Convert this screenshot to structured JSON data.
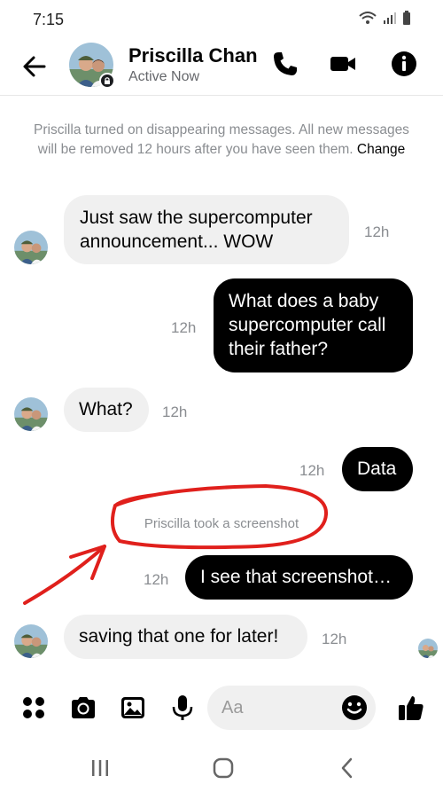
{
  "status_bar": {
    "time": "7:15",
    "icons": [
      "wifi-icon",
      "signal-icon",
      "battery-icon"
    ]
  },
  "header": {
    "contact_name": "Priscilla Chan",
    "contact_status": "Active Now",
    "icons": [
      "back-arrow-icon",
      "phone-icon",
      "video-camera-icon",
      "info-icon"
    ]
  },
  "notice": {
    "text": "Priscilla turned on disappearing messages. All new messages will be removed 12 hours after you have seen them.",
    "action": "Change"
  },
  "messages": [
    {
      "from": "Priscilla",
      "direction": "incoming",
      "text_lines": [
        "Just saw the supercomputer",
        "announcement... WOW"
      ],
      "time": "12h"
    },
    {
      "from": "me",
      "direction": "outgoing",
      "text_lines": [
        "What does a baby",
        "supercomputer call",
        "their father?"
      ],
      "time": "12h"
    },
    {
      "from": "Priscilla",
      "direction": "incoming",
      "text_lines": [
        "What?"
      ],
      "time": "12h"
    },
    {
      "from": "me",
      "direction": "outgoing",
      "text_lines": [
        "Data"
      ],
      "time": "12h"
    },
    {
      "from": "me",
      "direction": "outgoing",
      "text_lines": [
        "I see that screenshot…"
      ],
      "time": "12h"
    },
    {
      "from": "Priscilla",
      "direction": "incoming",
      "text_lines": [
        "saving that one for later!"
      ],
      "time": "12h"
    }
  ],
  "screenshot_notice": "Priscilla took a screenshot",
  "annotation": {
    "shape": "circle-and-arrow",
    "color": "#e0201c"
  },
  "composer": {
    "placeholder": "Aa",
    "value": "",
    "icons": [
      "apps-grid-icon",
      "camera-icon",
      "image-gallery-icon",
      "microphone-icon",
      "emoji-icon",
      "thumbs-up-icon"
    ]
  },
  "nav_bar": {
    "icons": [
      "recent-apps-icon",
      "home-icon",
      "back-chevron-icon"
    ]
  },
  "colors": {
    "outgoing_bubble": "#000000",
    "incoming_bubble": "#f0f0f0",
    "secondary_text": "#8a8d91",
    "annotation_red": "#e0201c"
  }
}
